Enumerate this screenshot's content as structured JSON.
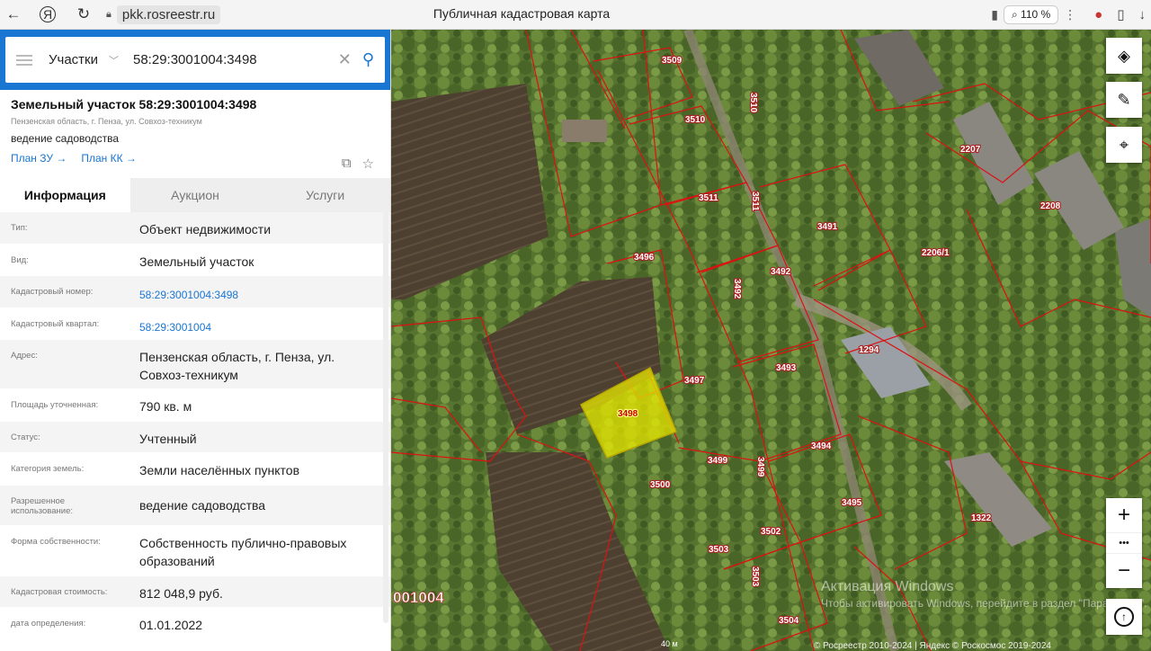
{
  "browser": {
    "url": "pkk.rosreestr.ru",
    "page_title": "Публичная кадастровая карта",
    "zoom": "110 %"
  },
  "search": {
    "layer": "Участки",
    "query": "58:29:3001004:3498"
  },
  "parcel": {
    "title": "Земельный участок 58:29:3001004:3498",
    "address_short": "Пензенская область, г. Пенза, ул. Совхоз-техникум",
    "use": "ведение садоводства",
    "link_plan_zu": "План ЗУ →",
    "link_plan_kk": "План КК →"
  },
  "tabs": [
    "Информация",
    "Аукцион",
    "Услуги"
  ],
  "properties": [
    {
      "label": "Тип:",
      "value": "Объект недвижимости",
      "link": false
    },
    {
      "label": "Вид:",
      "value": "Земельный участок",
      "link": false
    },
    {
      "label": "Кадастровый номер:",
      "value": "58:29:3001004:3498",
      "link": true
    },
    {
      "label": "Кадастровый квартал:",
      "value": "58:29:3001004",
      "link": true
    },
    {
      "label": "Адрес:",
      "value": "Пензенская область, г. Пенза, ул. Совхоз-техникум",
      "link": false
    },
    {
      "label": "Площадь уточненная:",
      "value": "790 кв. м",
      "link": false
    },
    {
      "label": "Статус:",
      "value": "Учтенный",
      "link": false
    },
    {
      "label": "Категория земель:",
      "value": "Земли населённых пунктов",
      "link": false
    },
    {
      "label": "Разрешенное использование:",
      "value": "ведение садоводства",
      "link": false
    },
    {
      "label": "Форма собственности:",
      "value": "Собственность публично-правовых образований",
      "link": false
    },
    {
      "label": "Кадастровая стоимость:",
      "value": "812 048,9 руб.",
      "link": false
    },
    {
      "label": "дата определения:",
      "value": "01.01.2022",
      "link": false
    }
  ],
  "map": {
    "parcel_labels": [
      "3509",
      "3510",
      "3510",
      "3511",
      "3511",
      "2207",
      "2208",
      "3491",
      "3492",
      "3492",
      "2206/1",
      "3496",
      "3493",
      "1294",
      "3497",
      "3498",
      "3494",
      "3499",
      "3499",
      "3500",
      "3495",
      "1322",
      "3502",
      "3503",
      "3503",
      "3504"
    ],
    "kvartal_label": "001004",
    "scale": "40 м",
    "copyright": "© Росреестр 2010-2024 | Яндекс © Роскосмос 2019-2024",
    "activation_title": "Активация Windows",
    "activation_text": "Чтобы активировать Windows, перейдите в раздел \"Параметры\".",
    "selected_color": "#e8e800"
  }
}
